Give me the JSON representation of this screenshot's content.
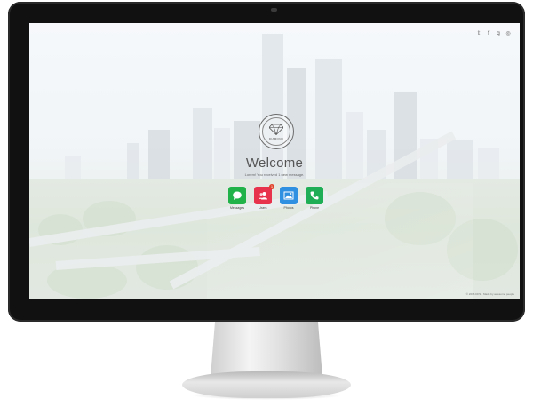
{
  "social": {
    "icons": [
      "twitter-icon",
      "facebook-icon",
      "google-plus-icon",
      "instagram-icon"
    ],
    "glyphs": [
      "𝕥",
      "f",
      "g",
      "◎"
    ]
  },
  "logo": {
    "text": "DIAMOND"
  },
  "welcome": {
    "title": "Welcome",
    "subtitle": "Lorem! You received 1 new message."
  },
  "apps": [
    {
      "label": "Messages",
      "color": "#21b34a",
      "icon": "chat-bubble-icon",
      "badge": ""
    },
    {
      "label": "Users",
      "color": "#e8334c",
      "icon": "users-icon",
      "badge": "1"
    },
    {
      "label": "Photos",
      "color": "#2f8fe0",
      "icon": "photo-icon",
      "badge": ""
    },
    {
      "label": "Phone",
      "color": "#1fae56",
      "icon": "phone-icon",
      "badge": ""
    }
  ],
  "footer": {
    "text": "© 2016 DFS · Made by awesome people"
  }
}
